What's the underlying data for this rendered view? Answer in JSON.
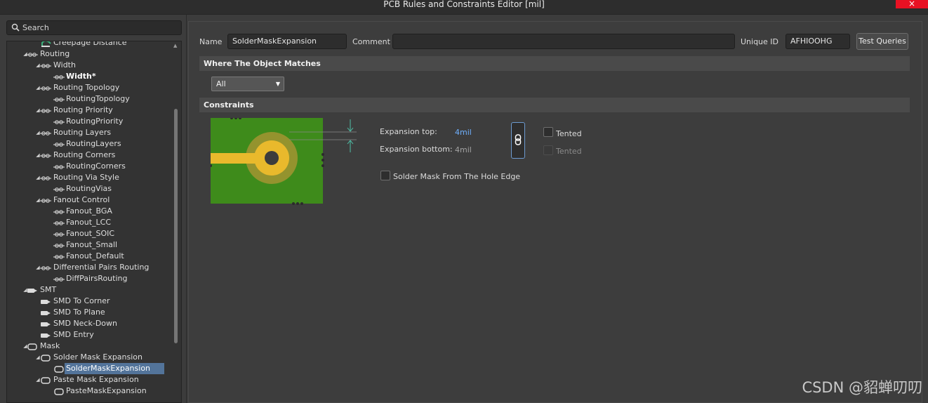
{
  "window": {
    "title": "PCB Rules and Constraints Editor [mil]",
    "close_glyph": "×"
  },
  "search": {
    "placeholder": "Search"
  },
  "tree": [
    {
      "label": "Creepage Distance",
      "icon": "creepage-icon"
    },
    {
      "label": "Routing",
      "icon": "routing-category-icon"
    },
    {
      "label": "Width",
      "icon": "rule-type-icon"
    },
    {
      "label": "Width*",
      "icon": "rule-instance-icon"
    },
    {
      "label": "Routing Topology",
      "icon": "rule-type-icon"
    },
    {
      "label": "RoutingTopology",
      "icon": "rule-instance-icon"
    },
    {
      "label": "Routing Priority",
      "icon": "rule-type-icon"
    },
    {
      "label": "RoutingPriority",
      "icon": "rule-instance-icon"
    },
    {
      "label": "Routing Layers",
      "icon": "rule-type-icon"
    },
    {
      "label": "RoutingLayers",
      "icon": "rule-instance-icon"
    },
    {
      "label": "Routing Corners",
      "icon": "rule-type-icon"
    },
    {
      "label": "RoutingCorners",
      "icon": "rule-instance-icon"
    },
    {
      "label": "Routing Via Style",
      "icon": "rule-type-icon"
    },
    {
      "label": "RoutingVias",
      "icon": "rule-instance-icon"
    },
    {
      "label": "Fanout Control",
      "icon": "rule-type-icon"
    },
    {
      "label": "Fanout_BGA",
      "icon": "rule-instance-icon"
    },
    {
      "label": "Fanout_LCC",
      "icon": "rule-instance-icon"
    },
    {
      "label": "Fanout_SOIC",
      "icon": "rule-instance-icon"
    },
    {
      "label": "Fanout_Small",
      "icon": "rule-instance-icon"
    },
    {
      "label": "Fanout_Default",
      "icon": "rule-instance-icon"
    },
    {
      "label": "Differential Pairs Routing",
      "icon": "rule-type-icon"
    },
    {
      "label": "DiffPairsRouting",
      "icon": "rule-instance-icon"
    },
    {
      "label": "SMT",
      "icon": "smt-category-icon"
    },
    {
      "label": "SMD To Corner",
      "icon": "smd-rule-icon"
    },
    {
      "label": "SMD To Plane",
      "icon": "smd-rule-icon"
    },
    {
      "label": "SMD Neck-Down",
      "icon": "smd-rule-icon"
    },
    {
      "label": "SMD Entry",
      "icon": "smd-rule-icon"
    },
    {
      "label": "Mask",
      "icon": "mask-category-icon"
    },
    {
      "label": "Solder Mask Expansion",
      "icon": "mask-rule-icon"
    },
    {
      "label": "SolderMaskExpansion",
      "icon": "mask-instance-icon"
    },
    {
      "label": "Paste Mask Expansion",
      "icon": "mask-rule-icon"
    },
    {
      "label": "PasteMaskExpansion",
      "icon": "mask-instance-icon"
    }
  ],
  "rule": {
    "name_label": "Name",
    "name_value": "SolderMaskExpansion",
    "comment_label": "Comment",
    "comment_value": "",
    "uid_label": "Unique ID",
    "uid_value": "AFHIOOHG",
    "test_queries": "Test Queries"
  },
  "where_section": {
    "title": "Where The Object Matches",
    "selected": "All"
  },
  "constraints": {
    "title": "Constraints",
    "expansion_top_label": "Expansion top:",
    "expansion_top_value": "4mil",
    "expansion_bottom_label": "Expansion bottom:",
    "expansion_bottom_value": "4mil",
    "tented_top": "Tented",
    "tented_bottom": "Tented",
    "hole_edge": "Solder Mask From The Hole Edge"
  },
  "watermark": "CSDN @貂蝉叨叨",
  "colors": {
    "board_green": "#3e8b1b",
    "pad_yellow": "#e9b92c",
    "mask_ring": "#94932e",
    "selection": "#53749a",
    "link_blue": "#6fb1ff"
  }
}
